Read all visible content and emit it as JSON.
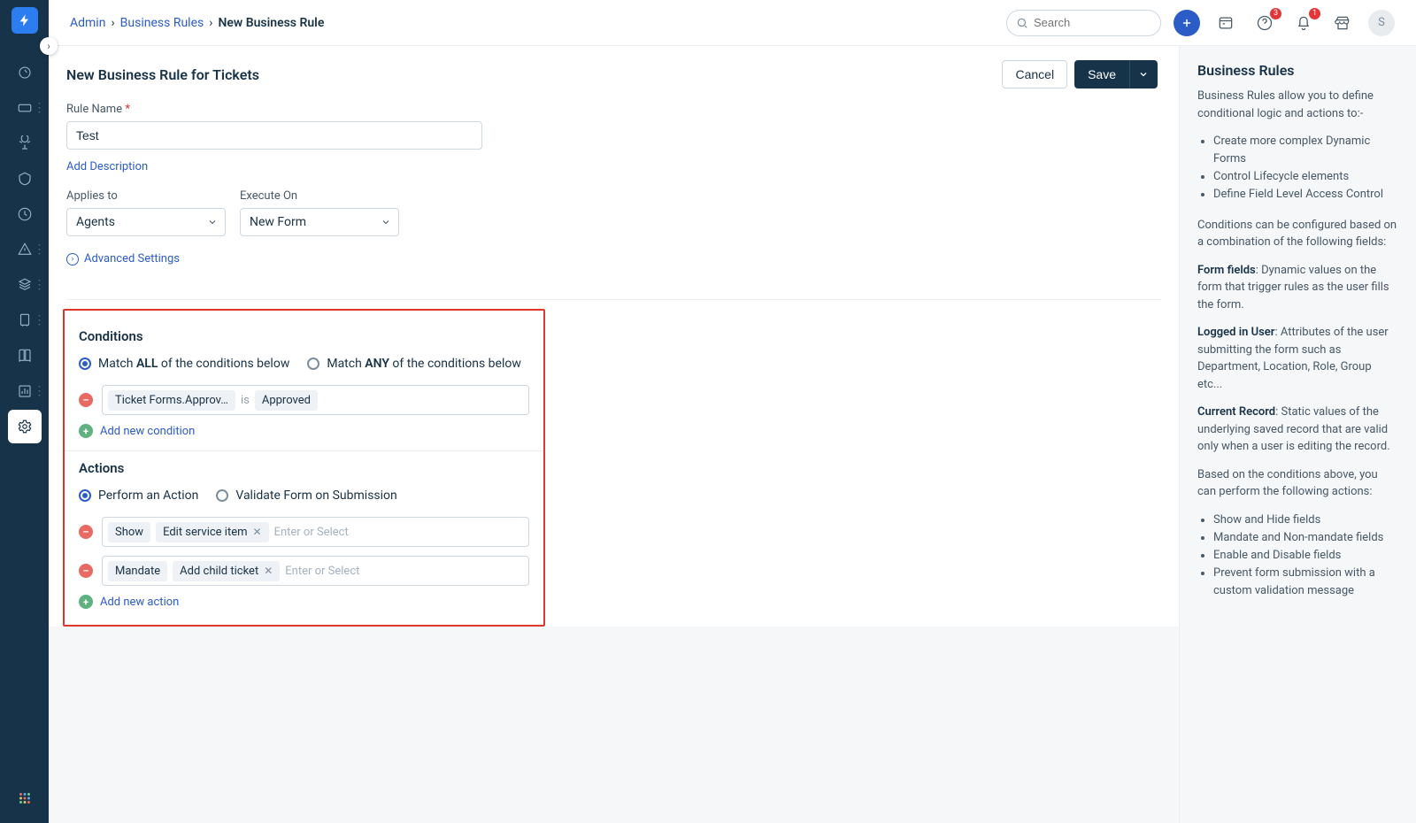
{
  "breadcrumbs": {
    "admin": "Admin",
    "business_rules": "Business Rules",
    "current": "New Business Rule"
  },
  "search": {
    "placeholder": "Search"
  },
  "topbar": {
    "badge_help": "3",
    "badge_bell": "1",
    "avatar": "S"
  },
  "header": {
    "title": "New Business Rule for Tickets",
    "cancel": "Cancel",
    "save": "Save"
  },
  "form": {
    "rule_name_label": "Rule Name",
    "rule_name_value": "Test",
    "add_description": "Add Description",
    "applies_to_label": "Applies to",
    "applies_to_value": "Agents",
    "execute_on_label": "Execute On",
    "execute_on_value": "New Form",
    "advanced": "Advanced Settings"
  },
  "conditions": {
    "title": "Conditions",
    "match_all_pre": "Match ",
    "match_all_bold": "ALL",
    "match_all_post": " of the conditions below",
    "match_any_pre": "Match ",
    "match_any_bold": "ANY",
    "match_any_post": " of the conditions below",
    "row": {
      "field": "Ticket Forms.Approv…",
      "op": "is",
      "value": "Approved"
    },
    "add": "Add new condition"
  },
  "actions": {
    "title": "Actions",
    "perform": "Perform an Action",
    "validate": "Validate Form on Submission",
    "rows": [
      {
        "verb": "Show",
        "target": "Edit service item",
        "placeholder": "Enter or Select"
      },
      {
        "verb": "Mandate",
        "target": "Add child ticket",
        "placeholder": "Enter or Select"
      }
    ],
    "add": "Add new action"
  },
  "help": {
    "title": "Business Rules",
    "intro": "Business Rules allow you to define conditional logic and actions to:-",
    "bullets1": [
      "Create more complex Dynamic Forms",
      "Control Lifecycle elements",
      "Define Field Level Access Control"
    ],
    "cond_intro": "Conditions can be configured based on a combination of the following fields:",
    "form_fields_b": "Form fields",
    "form_fields_t": ": Dynamic values on the form that trigger rules as the user fills the form.",
    "logged_b": "Logged in User",
    "logged_t": ": Attributes of the user submitting the form such as Department, Location, Role, Group etc...",
    "current_b": "Current Record",
    "current_t": ": Static values of the underlying saved record that are valid only when a user is editing the record.",
    "actions_intro": "Based on the conditions above, you can perform the following actions:",
    "bullets2": [
      "Show and Hide fields",
      "Mandate and Non-mandate fields",
      "Enable and Disable fields",
      "Prevent form submission with a custom validation message"
    ]
  }
}
